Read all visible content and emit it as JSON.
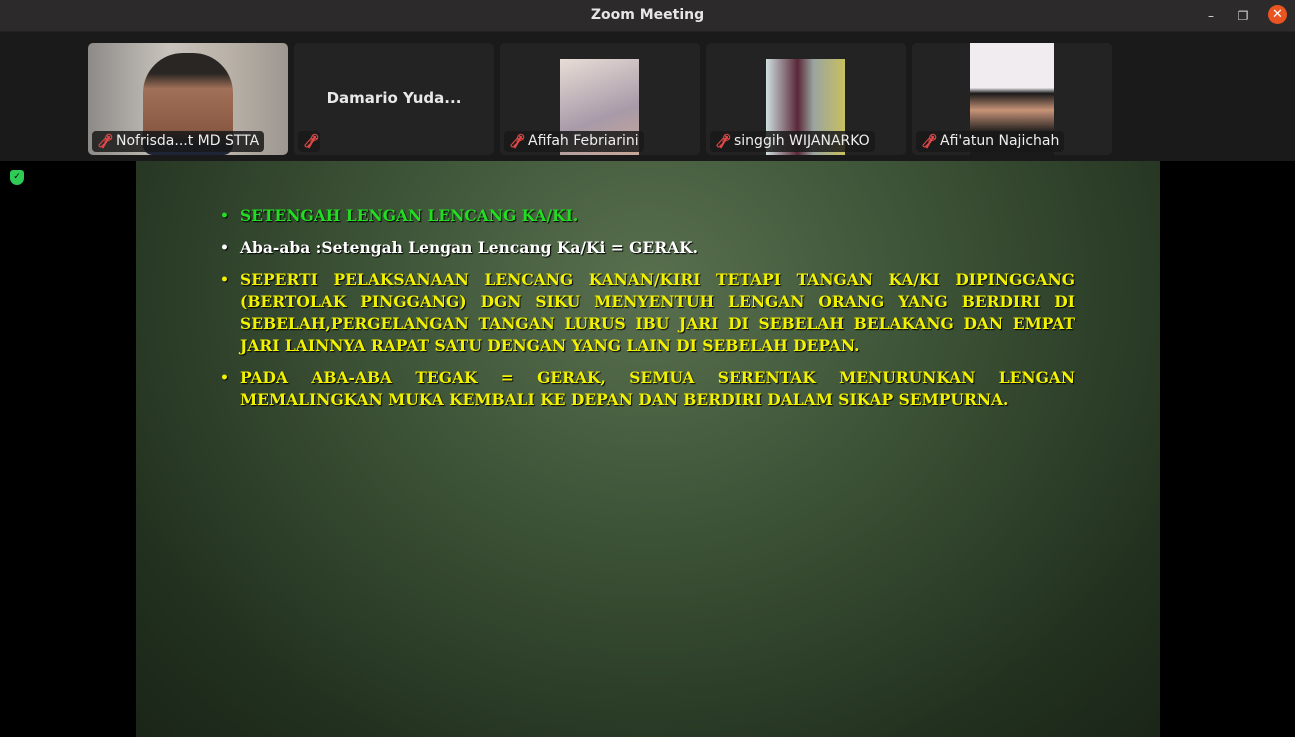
{
  "window": {
    "title": "Zoom Meeting",
    "minimize": "–",
    "maximize": "❐",
    "close": "✕"
  },
  "participants": [
    {
      "name": "Nofrisda...t MD STTA",
      "muted": true,
      "video": true
    },
    {
      "name": "",
      "display_name": "Damario Yuda...",
      "muted": true,
      "video": false
    },
    {
      "name": "Afifah Febriarini",
      "muted": true,
      "video": true
    },
    {
      "name": "singgih WIJANARKO",
      "muted": true,
      "video": true
    },
    {
      "name": "Afi'atun Najichah",
      "muted": true,
      "video": true
    }
  ],
  "slide": {
    "bullets": [
      {
        "text": "SETENGAH LENGAN LENCANG KA/KI.",
        "color": "#22dd22"
      },
      {
        "text": "Aba-aba :Setengah Lengan Lencang Ka/Ki = GERAK.",
        "color": "#ffffff"
      },
      {
        "text": "SEPERTI PELAKSANAAN LENCANG KANAN/KIRI TETAPI TANGAN KA/KI DIPINGGANG (BERTOLAK PINGGANG) DGN SIKU MENYENTUH LENGAN ORANG YANG BERDIRI DI SEBELAH,PERGELANGAN TANGAN LURUS IBU JARI DI SEBELAH BELAKANG DAN EMPAT JARI LAINNYA RAPAT SATU DENGAN YANG LAIN DI SEBELAH DEPAN.",
        "color": "#f2f200"
      },
      {
        "text": "PADA ABA-ABA TEGAK = GERAK, SEMUA SERENTAK MENURUNKAN LENGAN MEMALINGKAN MUKA KEMBALI KE DEPAN DAN BERDIRI DALAM SIKAP SEMPURNA.",
        "color": "#f2f200"
      }
    ],
    "bullet_glyph": "•"
  }
}
